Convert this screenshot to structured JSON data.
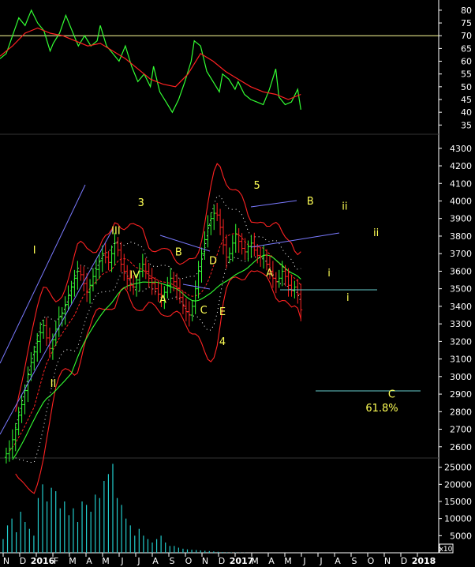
{
  "chart_data": [
    {
      "type": "line",
      "panel": "oscillator",
      "y_ticks": [
        35,
        40,
        45,
        50,
        55,
        60,
        65,
        70,
        75,
        80
      ],
      "ylim": [
        32,
        84
      ],
      "reference_level": 70,
      "series": [
        {
          "color": "#33ff33",
          "points": [
            [
              0,
              61
            ],
            [
              2,
              63
            ],
            [
              4,
              70
            ],
            [
              6,
              77
            ],
            [
              8,
              74
            ],
            [
              10,
              80
            ],
            [
              12,
              75
            ],
            [
              14,
              72
            ],
            [
              16,
              64
            ],
            [
              17,
              67
            ],
            [
              19,
              71
            ],
            [
              21,
              78
            ],
            [
              23,
              72
            ],
            [
              25,
              66
            ],
            [
              27,
              70
            ],
            [
              29,
              66
            ],
            [
              31,
              68
            ],
            [
              32,
              74
            ],
            [
              34,
              66
            ],
            [
              36,
              63
            ],
            [
              38,
              60
            ],
            [
              40,
              66
            ],
            [
              42,
              58
            ],
            [
              44,
              52
            ],
            [
              46,
              55
            ],
            [
              48,
              50
            ],
            [
              49,
              58
            ],
            [
              51,
              48
            ],
            [
              53,
              44
            ],
            [
              55,
              40
            ],
            [
              57,
              45
            ],
            [
              59,
              52
            ],
            [
              61,
              60
            ],
            [
              62,
              68
            ],
            [
              64,
              66
            ],
            [
              66,
              56
            ],
            [
              68,
              52
            ],
            [
              70,
              48
            ],
            [
              71,
              55
            ],
            [
              73,
              53
            ],
            [
              75,
              49
            ],
            [
              76,
              52
            ],
            [
              78,
              47
            ],
            [
              80,
              45
            ],
            [
              82,
              44
            ],
            [
              84,
              43
            ],
            [
              86,
              49
            ],
            [
              88,
              57
            ],
            [
              89,
              46
            ],
            [
              91,
              43
            ],
            [
              93,
              44
            ],
            [
              95,
              49
            ],
            [
              96,
              41
            ]
          ]
        },
        {
          "color": "#ff2222",
          "points": [
            [
              0,
              62
            ],
            [
              4,
              66
            ],
            [
              8,
              71
            ],
            [
              12,
              73
            ],
            [
              16,
              71
            ],
            [
              20,
              70
            ],
            [
              24,
              68
            ],
            [
              28,
              66
            ],
            [
              32,
              67
            ],
            [
              36,
              64
            ],
            [
              40,
              61
            ],
            [
              44,
              57
            ],
            [
              48,
              53
            ],
            [
              52,
              51
            ],
            [
              56,
              50
            ],
            [
              60,
              55
            ],
            [
              64,
              63
            ],
            [
              68,
              60
            ],
            [
              72,
              56
            ],
            [
              76,
              53
            ],
            [
              80,
              50
            ],
            [
              84,
              48
            ],
            [
              88,
              47
            ],
            [
              92,
              45
            ],
            [
              96,
              47
            ]
          ]
        }
      ]
    },
    {
      "type": "candlestick",
      "panel": "price",
      "y_ticks": [
        2600,
        2700,
        2800,
        2900,
        3000,
        3100,
        3200,
        3300,
        3400,
        3500,
        3600,
        3700,
        3800,
        3900,
        4000,
        4100,
        4200,
        4300
      ],
      "ylim": [
        2545,
        4335
      ],
      "x_labels": [
        "N",
        "D",
        "2016",
        "F",
        "M",
        "A",
        "M",
        "J",
        "J",
        "A",
        "S",
        "O",
        "N",
        "D",
        "2017",
        "M",
        "A",
        "M",
        "J",
        "J",
        "A",
        "S",
        "O",
        "N",
        "D",
        "2018"
      ],
      "x_bold": [
        "2016",
        "2017",
        "2018"
      ],
      "close": [
        2560,
        2590,
        2640,
        2700,
        2780,
        2840,
        2920,
        3010,
        3080,
        3140,
        3200,
        3250,
        3290,
        3220,
        3160,
        3210,
        3270,
        3340,
        3360,
        3410,
        3460,
        3510,
        3560,
        3600,
        3580,
        3530,
        3480,
        3520,
        3570,
        3610,
        3660,
        3700,
        3680,
        3650,
        3700,
        3760,
        3720,
        3640,
        3600,
        3560,
        3520,
        3510,
        3550,
        3600,
        3640,
        3600,
        3560,
        3530,
        3500,
        3470,
        3450,
        3480,
        3520,
        3560,
        3540,
        3500,
        3450,
        3400,
        3370,
        3350,
        3400,
        3500,
        3600,
        3700,
        3780,
        3860,
        3900,
        3930,
        3920,
        3850,
        3750,
        3680,
        3700,
        3760,
        3810,
        3770,
        3730,
        3710,
        3740,
        3760,
        3720,
        3690,
        3680,
        3690,
        3640,
        3600,
        3560,
        3540,
        3560,
        3600,
        3570,
        3520,
        3490,
        3510,
        3470,
        3380
      ]
    },
    {
      "type": "bar",
      "panel": "volume",
      "y_ticks": [
        5000,
        10000,
        15000,
        20000,
        25000
      ],
      "ylim": [
        0,
        27000
      ],
      "values": [
        4000,
        8000,
        10000,
        6000,
        12000,
        9000,
        7000,
        5000,
        16000,
        20000,
        15000,
        19000,
        18000,
        13000,
        15000,
        11000,
        13000,
        9000,
        15000,
        14000,
        12000,
        17000,
        16000,
        21000,
        23000,
        26000,
        16000,
        14000,
        10000,
        8000,
        5000,
        7000,
        5000,
        4000,
        3000,
        4000,
        5000,
        3000,
        2000,
        2000,
        1500,
        1200,
        1000,
        900,
        800,
        700,
        600,
        500,
        400,
        300,
        200,
        150,
        100,
        80,
        60,
        50
      ]
    }
  ],
  "annotations": {
    "wave_labels": [
      {
        "text": "I",
        "at": [
          11,
          3700
        ]
      },
      {
        "text": "II",
        "at": [
          17,
          2940
        ]
      },
      {
        "text": "III",
        "at": [
          37,
          3810
        ]
      },
      {
        "text": "IV",
        "at": [
          43,
          3560
        ]
      },
      {
        "text": "3",
        "at": [
          45,
          3970
        ]
      },
      {
        "text": "A",
        "at": [
          52,
          3420
        ]
      },
      {
        "text": "B",
        "at": [
          57,
          3690
        ]
      },
      {
        "text": "C",
        "at": [
          65,
          3360
        ]
      },
      {
        "text": "D",
        "at": [
          68,
          3640
        ]
      },
      {
        "text": "E",
        "at": [
          71,
          3350
        ]
      },
      {
        "text": "4",
        "at": [
          71,
          3180
        ]
      },
      {
        "text": "5",
        "at": [
          82,
          4070
        ]
      },
      {
        "text": "A",
        "at": [
          86,
          3570
        ]
      },
      {
        "text": "B",
        "at": [
          99,
          3980
        ]
      },
      {
        "text": "ii",
        "at": [
          110,
          3950
        ]
      },
      {
        "text": "ii",
        "at": [
          120,
          3800
        ]
      },
      {
        "text": "i",
        "at": [
          105,
          3570
        ]
      },
      {
        "text": "i",
        "at": [
          111,
          3430
        ]
      },
      {
        "text": "C",
        "at": [
          125,
          2880
        ]
      }
    ],
    "fib_label": "61.8%",
    "volume_multiplier": "x10"
  },
  "colors": {
    "background": "#000000",
    "price_line": "#33ff33",
    "bands": "#ff2222",
    "fast_ma": "#33ff33",
    "volume": "#22cccc",
    "labels": "#ffff55",
    "guide": "#7a7aff",
    "level": "#66cccc",
    "axis_text": "#ffffff"
  }
}
